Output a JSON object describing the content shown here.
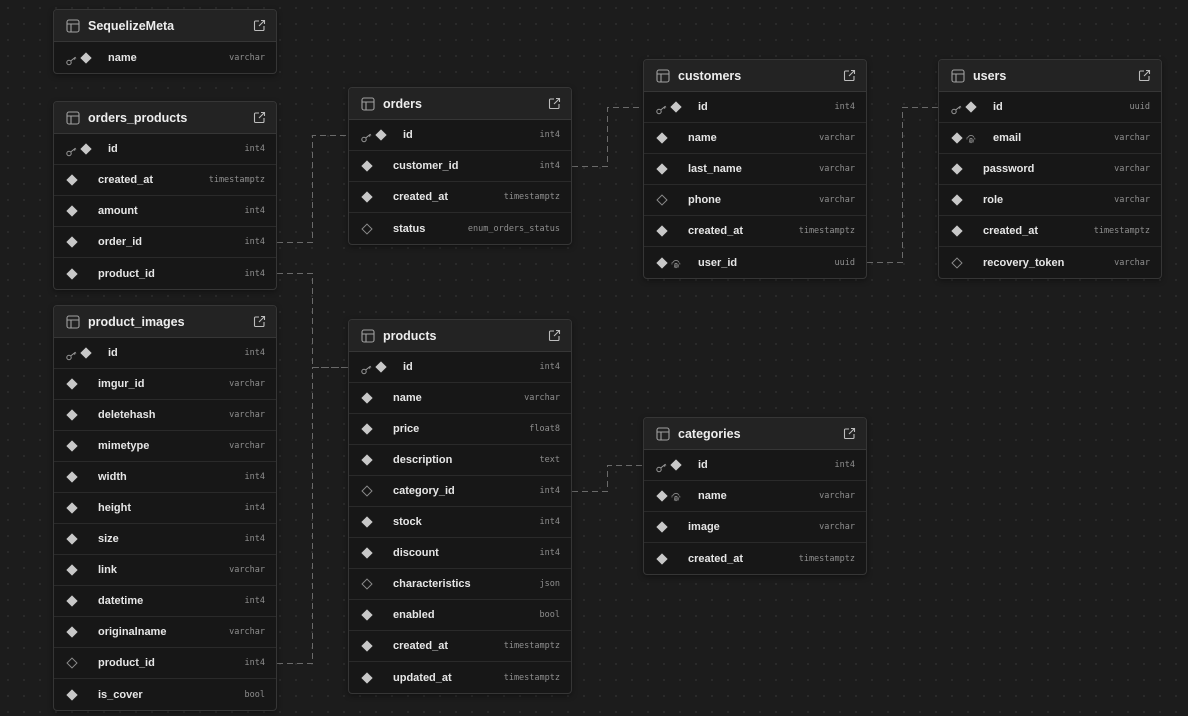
{
  "colors": {
    "background": "#1c1c1c",
    "card": "#171717",
    "header": "#232323",
    "border": "#363636",
    "link": "#6a6a6a"
  },
  "tables": [
    {
      "id": "SequelizeMeta",
      "title": "SequelizeMeta",
      "columns": [
        {
          "name": "name",
          "type": "varchar",
          "pk": true,
          "nullable": false
        }
      ]
    },
    {
      "id": "orders_products",
      "title": "orders_products",
      "columns": [
        {
          "name": "id",
          "type": "int4",
          "pk": true,
          "nullable": false
        },
        {
          "name": "created_at",
          "type": "timestamptz",
          "nullable": false
        },
        {
          "name": "amount",
          "type": "int4",
          "nullable": false
        },
        {
          "name": "order_id",
          "type": "int4",
          "nullable": false
        },
        {
          "name": "product_id",
          "type": "int4",
          "nullable": false
        }
      ]
    },
    {
      "id": "product_images",
      "title": "product_images",
      "columns": [
        {
          "name": "id",
          "type": "int4",
          "pk": true,
          "nullable": false
        },
        {
          "name": "imgur_id",
          "type": "varchar",
          "nullable": false
        },
        {
          "name": "deletehash",
          "type": "varchar",
          "nullable": false
        },
        {
          "name": "mimetype",
          "type": "varchar",
          "nullable": false
        },
        {
          "name": "width",
          "type": "int4",
          "nullable": false
        },
        {
          "name": "height",
          "type": "int4",
          "nullable": false
        },
        {
          "name": "size",
          "type": "int4",
          "nullable": false
        },
        {
          "name": "link",
          "type": "varchar",
          "nullable": false
        },
        {
          "name": "datetime",
          "type": "int4",
          "nullable": false
        },
        {
          "name": "originalname",
          "type": "varchar",
          "nullable": false
        },
        {
          "name": "product_id",
          "type": "int4",
          "nullable": true
        },
        {
          "name": "is_cover",
          "type": "bool",
          "nullable": false
        }
      ]
    },
    {
      "id": "orders",
      "title": "orders",
      "columns": [
        {
          "name": "id",
          "type": "int4",
          "pk": true,
          "nullable": false
        },
        {
          "name": "customer_id",
          "type": "int4",
          "nullable": false
        },
        {
          "name": "created_at",
          "type": "timestamptz",
          "nullable": false
        },
        {
          "name": "status",
          "type": "enum_orders_status",
          "nullable": true
        }
      ]
    },
    {
      "id": "products",
      "title": "products",
      "columns": [
        {
          "name": "id",
          "type": "int4",
          "pk": true,
          "nullable": false
        },
        {
          "name": "name",
          "type": "varchar",
          "nullable": false
        },
        {
          "name": "price",
          "type": "float8",
          "nullable": false
        },
        {
          "name": "description",
          "type": "text",
          "nullable": false
        },
        {
          "name": "category_id",
          "type": "int4",
          "nullable": true
        },
        {
          "name": "stock",
          "type": "int4",
          "nullable": false
        },
        {
          "name": "discount",
          "type": "int4",
          "nullable": false
        },
        {
          "name": "characteristics",
          "type": "json",
          "nullable": true
        },
        {
          "name": "enabled",
          "type": "bool",
          "nullable": false
        },
        {
          "name": "created_at",
          "type": "timestamptz",
          "nullable": false
        },
        {
          "name": "updated_at",
          "type": "timestamptz",
          "nullable": false
        }
      ]
    },
    {
      "id": "customers",
      "title": "customers",
      "columns": [
        {
          "name": "id",
          "type": "int4",
          "pk": true,
          "nullable": false
        },
        {
          "name": "name",
          "type": "varchar",
          "nullable": false
        },
        {
          "name": "last_name",
          "type": "varchar",
          "nullable": false
        },
        {
          "name": "phone",
          "type": "varchar",
          "nullable": true
        },
        {
          "name": "created_at",
          "type": "timestamptz",
          "nullable": false
        },
        {
          "name": "user_id",
          "type": "uuid",
          "nullable": false,
          "unique": true
        }
      ]
    },
    {
      "id": "users",
      "title": "users",
      "columns": [
        {
          "name": "id",
          "type": "uuid",
          "pk": true,
          "nullable": false
        },
        {
          "name": "email",
          "type": "varchar",
          "nullable": false,
          "unique": true
        },
        {
          "name": "password",
          "type": "varchar",
          "nullable": false
        },
        {
          "name": "role",
          "type": "varchar",
          "nullable": false
        },
        {
          "name": "created_at",
          "type": "timestamptz",
          "nullable": false
        },
        {
          "name": "recovery_token",
          "type": "varchar",
          "nullable": true
        }
      ]
    },
    {
      "id": "categories",
      "title": "categories",
      "columns": [
        {
          "name": "id",
          "type": "int4",
          "pk": true,
          "nullable": false
        },
        {
          "name": "name",
          "type": "varchar",
          "nullable": false,
          "unique": true
        },
        {
          "name": "image",
          "type": "varchar",
          "nullable": false
        },
        {
          "name": "created_at",
          "type": "timestamptz",
          "nullable": false
        }
      ]
    }
  ],
  "relations": [
    {
      "from": "orders_products.order_id",
      "to": "orders.id"
    },
    {
      "from": "orders_products.product_id",
      "to": "products.id"
    },
    {
      "from": "product_images.product_id",
      "to": "products.id"
    },
    {
      "from": "orders.customer_id",
      "to": "customers.id"
    },
    {
      "from": "products.category_id",
      "to": "categories.id"
    },
    {
      "from": "customers.user_id",
      "to": "users.id"
    }
  ]
}
